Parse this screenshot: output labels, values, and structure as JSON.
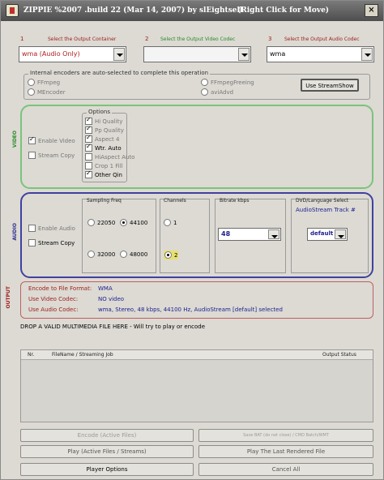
{
  "titlebar": {
    "title": "ZIPPIE %2007 .build 22 (Mar 14, 2007) by slEightsell",
    "hint": "(Right Click for Move)",
    "close": "×"
  },
  "selectors": {
    "output_container": {
      "index": "1",
      "label": "Select the Output Container",
      "value": "wma (Audio Only)"
    },
    "video_codec": {
      "index": "2",
      "label": "Select the Output Video Codec",
      "value": ""
    },
    "audio_codec": {
      "index": "3",
      "label": "Select the Output Audio Codec",
      "value": "wma"
    }
  },
  "encoders_group": {
    "label": "Internal encoders are auto-selected to complete this operation",
    "options_left": [
      "FFmpeg",
      "MEncoder"
    ],
    "options_right": [
      "FFmpegFreeing",
      "aviAdvd"
    ],
    "show_streams_button": "Use StreamShow"
  },
  "video_panel": {
    "side_label": "VIDEO",
    "enable_video": "Enable Video",
    "stream_copy": "Stream Copy",
    "options_title": "Options",
    "options": [
      "Hi Quality",
      "Pp Quality",
      "Aspect 4",
      "Wtr. Auto",
      "HiAspect Auto",
      "Crop 1 Fill",
      "Other Qin"
    ]
  },
  "audio_panel": {
    "side_label": "AUDIO",
    "enable_audio": "Enable Audio",
    "stream_copy": "Stream Copy",
    "sampling_title": "Sampling Freq",
    "rates": [
      "22050",
      "44100",
      "32000",
      "48000"
    ],
    "channels_title": "Channels",
    "channel_opts": [
      "1",
      "2"
    ],
    "bitrate_title": "Bitrate kbps",
    "bitrate_value": "48",
    "dvd_title": "DVD/Language Select",
    "dvd_sub": "AudioStream  Track #",
    "dvd_value": "default"
  },
  "output_panel": {
    "side_label": "OUTPUT",
    "rows": [
      {
        "k": "Encode to File Format:",
        "v": "WMA"
      },
      {
        "k": "Use Video Codec:",
        "v": "NO video"
      },
      {
        "k": "Use Audio Codec:",
        "v": "wma, Stereo, 48 kbps, 44100 Hz, AudioStream [default] selected"
      }
    ]
  },
  "drop_hint": "DROP A VALID MULTIMEDIA FILE HERE - Will try to play or encode",
  "file_list": {
    "columns": [
      "Nr.",
      "FileName / Streaming Job",
      "Output Status"
    ]
  },
  "buttons": {
    "encode": "Encode (Active Files)",
    "save_batch": "Save BAT (do not close) / CMD Batch/WMT",
    "play_active": "Play (Active Files / Streams)",
    "play_last": "Play The Last Rendered File",
    "player_options": "Player Options",
    "cancel_all": "Cancel All"
  },
  "colors": {
    "video_border": "#7ac47a",
    "audio_border": "#4040a0",
    "output_border": "#c06060",
    "label_red": "#a02020",
    "label_green": "#2a8a2a"
  }
}
